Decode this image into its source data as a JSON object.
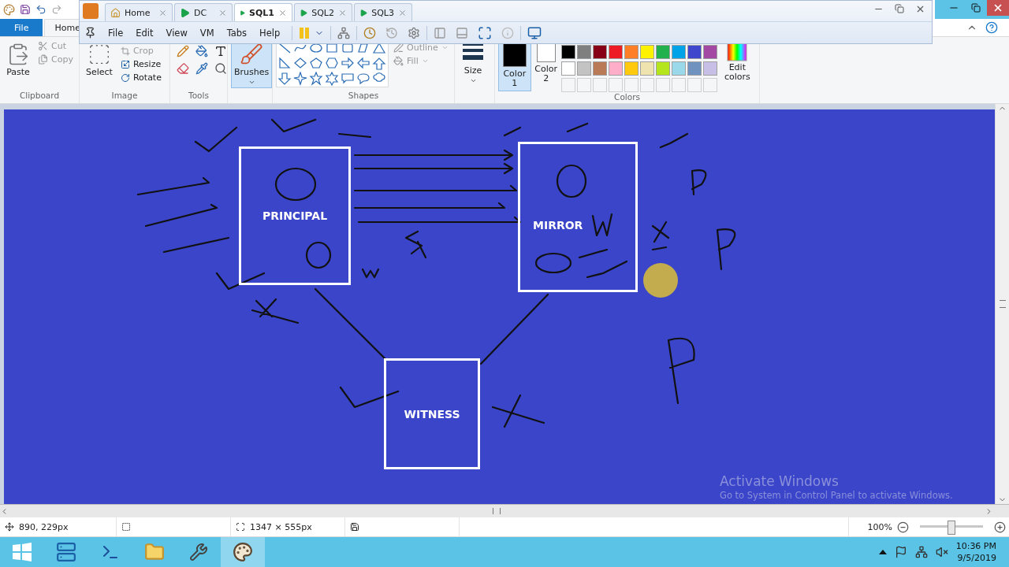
{
  "vm_window": {
    "tabs": [
      {
        "label": "Home",
        "kind": "home",
        "selected": false
      },
      {
        "label": "DC",
        "kind": "vm",
        "selected": false
      },
      {
        "label": "SQL1",
        "kind": "vm",
        "selected": true
      },
      {
        "label": "SQL2",
        "kind": "vm",
        "selected": false
      },
      {
        "label": "SQL3",
        "kind": "vm",
        "selected": false
      }
    ],
    "menu": [
      "File",
      "Edit",
      "View",
      "VM",
      "Tabs",
      "Help"
    ]
  },
  "ribbon_tabs": [
    {
      "label": "File",
      "kind": "app",
      "selected": false
    },
    {
      "label": "Home",
      "kind": "tab",
      "selected": true
    }
  ],
  "clipboard": {
    "paste": "Paste",
    "cut": "Cut",
    "copy": "Copy",
    "group": "Clipboard"
  },
  "image": {
    "select": "Select",
    "crop": "Crop",
    "resize": "Resize",
    "rotate": "Rotate",
    "group": "Image"
  },
  "tools": {
    "group": "Tools"
  },
  "brushes": {
    "label": "Brushes"
  },
  "shapes": {
    "outline": "Outline",
    "fill": "Fill",
    "group": "Shapes"
  },
  "size": {
    "label": "Size"
  },
  "color_slots": [
    {
      "label": "Color 1",
      "color": "#000000",
      "selected": true
    },
    {
      "label": "Color 2",
      "color": "#ffffff",
      "selected": false
    }
  ],
  "palette": [
    {
      "color": "#000000"
    },
    {
      "color": "#7f7f7f"
    },
    {
      "color": "#880015"
    },
    {
      "color": "#ed1c24"
    },
    {
      "color": "#ff7f27"
    },
    {
      "color": "#fff200"
    },
    {
      "color": "#22b14c"
    },
    {
      "color": "#00a2e8"
    },
    {
      "color": "#3f48cc"
    },
    {
      "color": "#a349a4"
    },
    {
      "color": "#ffffff"
    },
    {
      "color": "#c3c3c3"
    },
    {
      "color": "#b97a57"
    },
    {
      "color": "#ffaec9"
    },
    {
      "color": "#ffc90e"
    },
    {
      "color": "#efe4b0"
    },
    {
      "color": "#b5e61d"
    },
    {
      "color": "#99d9ea"
    },
    {
      "color": "#7092be"
    },
    {
      "color": "#c8bfe7"
    }
  ],
  "edit_colors": "Edit colors",
  "colors_group": "Colors",
  "canvas": {
    "nodes": [
      {
        "label": "PRINCIPAL"
      },
      {
        "label": "MIRROR"
      },
      {
        "label": "WITNESS"
      }
    ]
  },
  "activation_notice": {
    "title": "Activate Windows",
    "text": "Go to System in Control Panel to activate Windows."
  },
  "status_bar": {
    "cursor": "890, 229px",
    "image_size": "1347 × 555px",
    "zoom": "100%",
    "zoom_slider": {
      "level": 0.5
    }
  },
  "taskbar": {
    "apps": [
      {
        "kind": "start",
        "selected": false
      },
      {
        "kind": "server",
        "selected": false
      },
      {
        "kind": "shell",
        "selected": false
      },
      {
        "kind": "folder",
        "selected": false
      },
      {
        "kind": "tools",
        "selected": false
      },
      {
        "kind": "paint",
        "selected": true
      }
    ],
    "time": "10:36 PM",
    "date": "9/5/2019"
  }
}
